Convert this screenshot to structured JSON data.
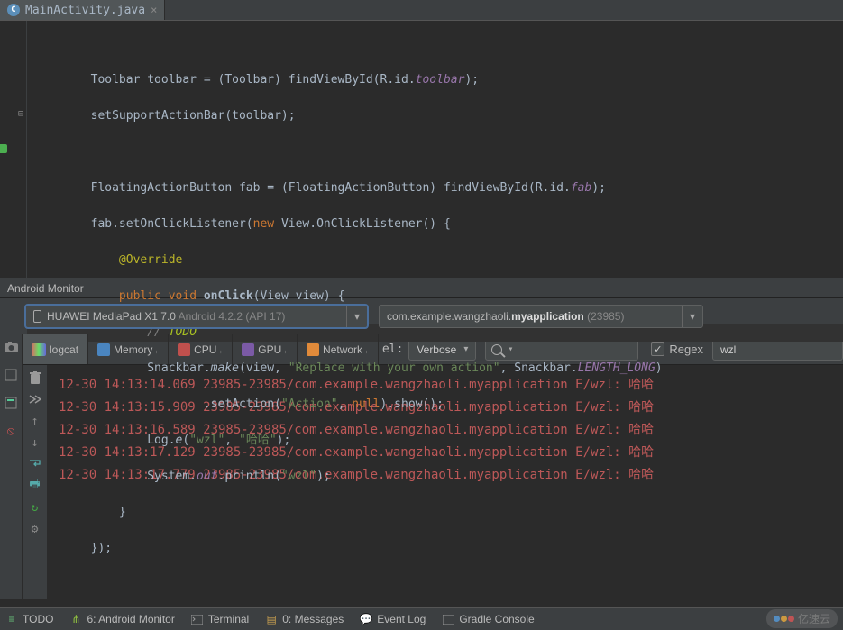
{
  "tab": {
    "filename": "MainActivity.java",
    "icon_letter": "C"
  },
  "code": {
    "l1_a": "        Toolbar toolbar = (Toolbar) findViewById(R.id.",
    "l1_b": "toolbar",
    "l1_c": ");",
    "l2": "        setSupportActionBar(toolbar);",
    "l3_a": "        FloatingActionButton fab = (FloatingActionButton) findViewById(R.id.",
    "l3_b": "fab",
    "l3_c": ");",
    "l4_a": "        fab.setOnClickListener(",
    "l4_kw": "new",
    "l4_b": " View.OnClickListener() {",
    "l5_anno": "            @Override",
    "l6_a": "            ",
    "l6_pub": "public ",
    "l6_void": "void ",
    "l6_name": "onClick",
    "l6_b": "(View view) {",
    "l7_a": "                ",
    "l7_c1": "// ",
    "l7_c2": "TODO",
    "l8_a": "                Snackbar.",
    "l8_make": "make",
    "l8_b": "(view, ",
    "l8_str": "\"Replace with your own action\"",
    "l8_c": ", Snackbar.",
    "l8_len": "LENGTH_LONG",
    "l8_d": ")",
    "l9_a": "                        .setAction(",
    "l9_str": "\"Action\"",
    "l9_b": ", ",
    "l9_null": "null",
    "l9_c": ").show();",
    "l10_a": "                Log.",
    "l10_e": "e",
    "l10_b": "(",
    "l10_s1": "\"wzl\"",
    "l10_c": ", ",
    "l10_s2": "\"哈哈\"",
    "l10_d": ");",
    "l11_a": "                System.",
    "l11_out": "out",
    "l11_b": ".println(",
    "l11_s": "\"wzl\"",
    "l11_c": ");",
    "l12": "            }",
    "l13": "        });"
  },
  "monitor": {
    "title": "Android Monitor",
    "device_name": "HUAWEI MediaPad X1 7.0 ",
    "device_api": "Android 4.2.2 (API 17)",
    "process_pkg_pre": "com.example.wangzhaoli.",
    "process_pkg_bold": "myapplication",
    "process_pid": " (23985)"
  },
  "logcat_tabs": {
    "logcat": "logcat",
    "memory": "Memory",
    "cpu": "CPU",
    "gpu": "GPU",
    "network": "Network",
    "cut_label": "el:"
  },
  "filter": {
    "level": "Verbose",
    "regex_label": "Regex",
    "filter_text": "wzl"
  },
  "log_lines": [
    "12-30 14:13:14.069 23985-23985/com.example.wangzhaoli.myapplication E/wzl: 哈哈",
    "12-30 14:13:15.909 23985-23985/com.example.wangzhaoli.myapplication E/wzl: 哈哈",
    "12-30 14:13:16.589 23985-23985/com.example.wangzhaoli.myapplication E/wzl: 哈哈",
    "12-30 14:13:17.129 23985-23985/com.example.wangzhaoli.myapplication E/wzl: 哈哈",
    "12-30 14:13:17.779 23985-23985/com.example.wangzhaoli.myapplication E/wzl: 哈哈"
  ],
  "status_bar": {
    "todo": "TODO",
    "am_num": "6",
    "am_label": ": Android Monitor",
    "terminal": "Terminal",
    "msg_num": "0",
    "msg_label": ": Messages",
    "event_log": "Event Log",
    "gradle": "Gradle Console"
  },
  "watermark": "亿速云"
}
